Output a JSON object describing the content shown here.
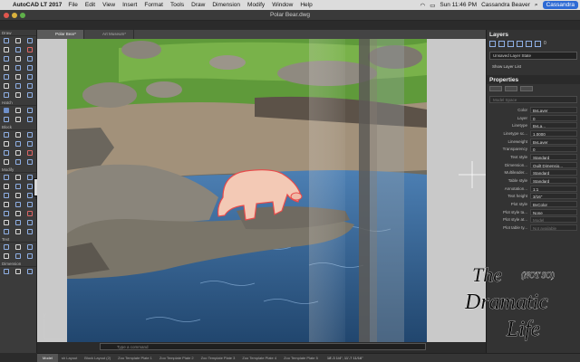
{
  "menubar": {
    "app_name": "AutoCAD LT 2017",
    "items": [
      "File",
      "Edit",
      "View",
      "Insert",
      "Format",
      "Tools",
      "Draw",
      "Dimension",
      "Modify",
      "Window",
      "Help"
    ],
    "clock": "Sun 11:46 PM",
    "user": "Cassandra Beaver",
    "user_pill": "Cassandra"
  },
  "window": {
    "title": "Polar Bear.dwg"
  },
  "palette": {
    "sections": [
      "Draw",
      "Hatch",
      "Block",
      "Modify",
      "Text",
      "Dimension"
    ],
    "toggle_label": "Tool"
  },
  "doc_tabs": [
    "Polar Bear*",
    "Art Museum*"
  ],
  "command_line": {
    "placeholder": "Type a command"
  },
  "statusbar": {
    "model": "Model",
    "layouts": [
      "sh Layout",
      "Block Layout (2)",
      "Zoo Template Plate 1",
      "Zoo Template Plate 2",
      "Zoo Template Plate 3",
      "Zoo Template Plate 4",
      "Zoo Template Plate 5"
    ],
    "coords": "18'-3 1/4\", 11'-7 11/16\""
  },
  "layers": {
    "title": "Layers",
    "current_layer": "0",
    "state_select": "Unsaved Layer State",
    "show_list": "Show Layer List"
  },
  "properties": {
    "title": "Properties",
    "selection": "Model Space",
    "rows": [
      {
        "label": "Color",
        "value": "ByLayer"
      },
      {
        "label": "Layer",
        "value": "0"
      },
      {
        "label": "Linetype",
        "value": "ByLa..."
      },
      {
        "label": "Linetype sc...",
        "value": "1.0000"
      },
      {
        "label": "Lineweight",
        "value": "ByLayer"
      },
      {
        "label": "Transparency",
        "value": "0"
      },
      {
        "label": "Text style",
        "value": "Standard"
      },
      {
        "label": "Dimension...",
        "value": "Quilt Dimensio..."
      },
      {
        "label": "Multileader...",
        "value": "Standard"
      },
      {
        "label": "Table style",
        "value": "Standard"
      },
      {
        "label": "Annotation...",
        "value": "1:1"
      },
      {
        "label": "Text height",
        "value": "3/16\""
      },
      {
        "label": "Plot style",
        "value": "ByColor"
      },
      {
        "label": "Plot style ta...",
        "value": "None"
      },
      {
        "label": "Plot style at...",
        "value": "Model"
      },
      {
        "label": "Plot table ty...",
        "value": "Not available"
      }
    ]
  },
  "watermark": {
    "line1": "The",
    "line2": "(NOT SO)",
    "line3": "Dramatic",
    "line4": "Life"
  },
  "colors": {
    "accent": "#2d6ad4",
    "bear_selection": "#e84a4a",
    "water": "#3b6fa8",
    "grass": "#5f9a3a"
  }
}
